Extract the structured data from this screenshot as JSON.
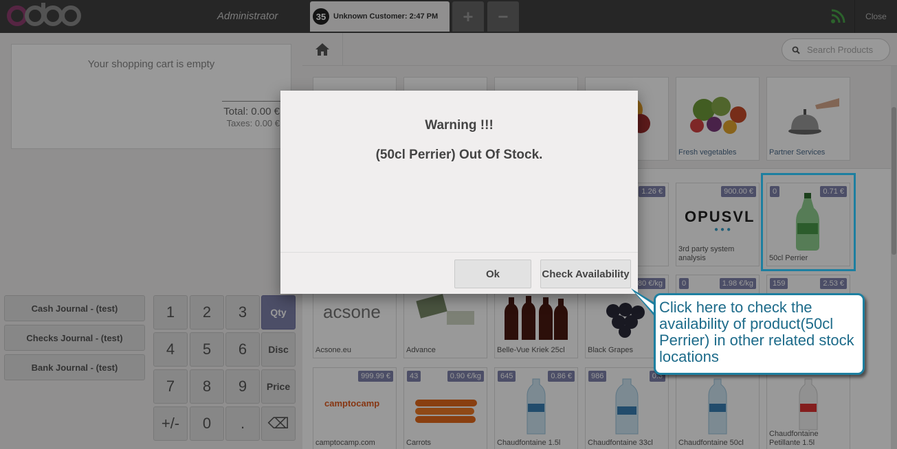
{
  "topbar": {
    "logo": "odoo",
    "user": "Administrator",
    "order_number": "35",
    "order_label": "Unknown Customer: 2:47 PM",
    "add_order": "+",
    "remove_order": "−",
    "close": "Close"
  },
  "cart": {
    "empty": "Your shopping cart is empty",
    "total": "Total: 0.00 €",
    "taxes": "Taxes: 0.00 €"
  },
  "journals": [
    "Cash Journal - (test)",
    "Checks Journal - (test)",
    "Bank Journal - (test)"
  ],
  "numpad": {
    "k1": "1",
    "k2": "2",
    "k3": "3",
    "qty": "Qty",
    "k4": "4",
    "k5": "5",
    "k6": "6",
    "disc": "Disc",
    "k7": "7",
    "k8": "8",
    "k9": "9",
    "price": "Price",
    "sign": "+/-",
    "k0": "0",
    "dot": ".",
    "backspace": "⌫"
  },
  "search": {
    "placeholder": "Search Products"
  },
  "categories": [
    {
      "name": ""
    },
    {
      "name": ""
    },
    {
      "name": ""
    },
    {
      "name": ""
    },
    {
      "name": "Fresh vegetables"
    },
    {
      "name": "Partner Services"
    }
  ],
  "products": {
    "row1": [
      {
        "price": "1.26 €"
      },
      {
        "name": "3rd party system analysis",
        "price": "900.00 €",
        "logo": "OPUSVL"
      },
      {
        "name": "50cl Perrier",
        "qty": "0",
        "price": "0.71 €"
      }
    ],
    "row2": [
      {
        "name": "Acsone.eu",
        "logo": "acsone"
      },
      {
        "name": "Advance"
      },
      {
        "name": "Belle-Vue Kriek 25cl"
      },
      {
        "name": "Black Grapes",
        "price": "80 €/kg"
      },
      {
        "qty": "0",
        "price": "1.98 €/kg"
      },
      {
        "qty": "159",
        "price": "2.53 €"
      }
    ],
    "row3": [
      {
        "name": "camptocamp.com",
        "price": "999.99 €",
        "logo": "camptocamp"
      },
      {
        "name": "Carrots",
        "qty": "43",
        "price": "0.90 €/kg"
      },
      {
        "name": "Chaudfontaine 1.5l",
        "qty": "645",
        "price": "0.86 €"
      },
      {
        "name": "Chaudfontaine 33cl",
        "qty": "986",
        "price": "0.3"
      },
      {
        "name": "Chaudfontaine 50cl"
      },
      {
        "name": "Chaudfontaine Petillante 1.5l"
      }
    ]
  },
  "dialog": {
    "title": "Warning !!!",
    "message": "(50cl Perrier) Out Of Stock.",
    "ok": "Ok",
    "check": "Check Availability"
  },
  "callout": "Click here to check the availability of product(50cl Perrier) in other related stock locations",
  "colors": {
    "accent": "#7f82ac",
    "callout": "#1d7fa0",
    "topbar": "#404040"
  }
}
